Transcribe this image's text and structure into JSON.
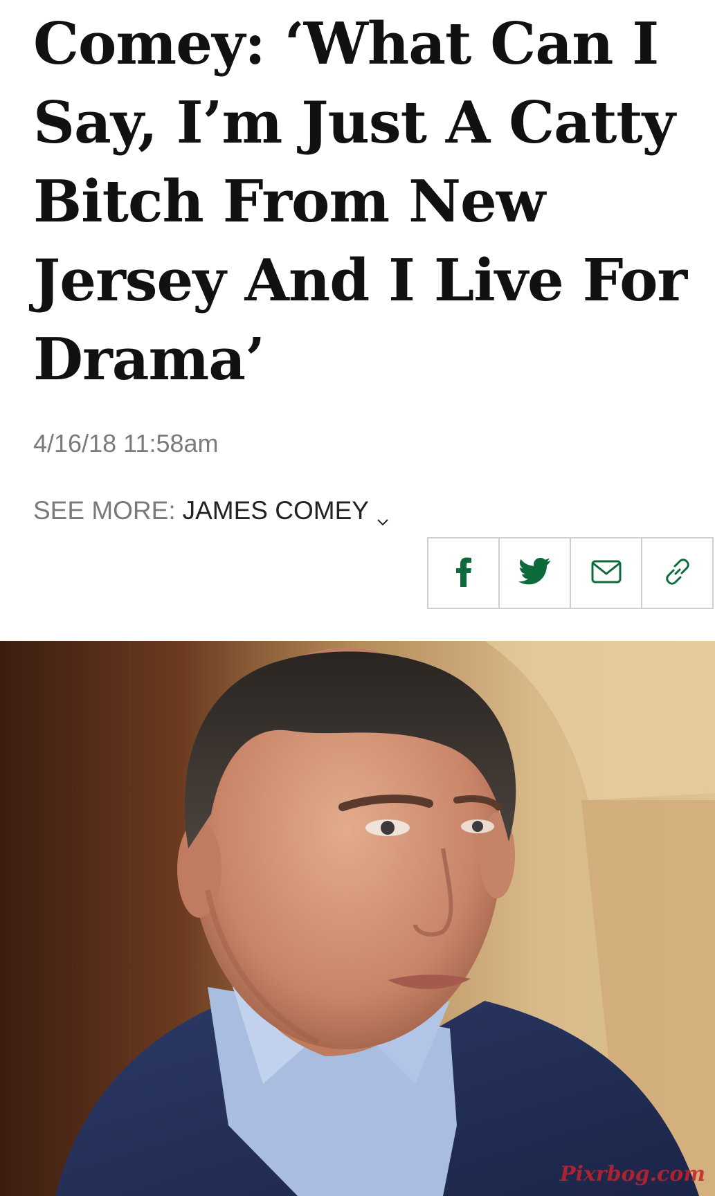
{
  "article": {
    "headline": "Comey: ‘What Can I Say, I’m Just A Catty Bitch From New Jersey And I Live For Drama’",
    "timestamp": "4/16/18 11:58am",
    "see_more_label": "SEE MORE:",
    "see_more_tag": "JAMES COMEY"
  },
  "share": {
    "icons": [
      "facebook-icon",
      "twitter-icon",
      "email-icon",
      "link-icon"
    ],
    "icon_color": "#0d6b3b"
  },
  "hero": {
    "watermark": "Pixrbog.com"
  }
}
